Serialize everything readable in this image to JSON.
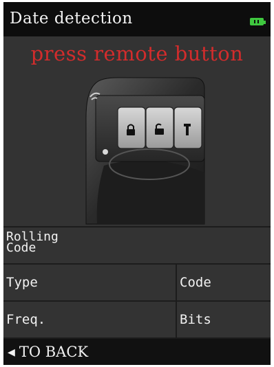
{
  "header": {
    "title": "Date detection",
    "battery_icon": "battery-full-icon",
    "battery_color": "#3fc83f"
  },
  "prompt": {
    "text": "press remote button",
    "color": "#d22c2c"
  },
  "remote_image": {
    "icon": "car-remote-key-icon",
    "buttons": [
      "lock-icon",
      "unlock-icon",
      "trunk-icon"
    ]
  },
  "fields": {
    "rolling_code_line1": "Rolling",
    "rolling_code_line2": "Code",
    "type_label": "Type",
    "code_label": "Code",
    "freq_label": "Freq.",
    "bits_label": "Bits"
  },
  "footer": {
    "back_arrow_icon": "left-triangle-icon",
    "back_label": "TO BACK"
  }
}
